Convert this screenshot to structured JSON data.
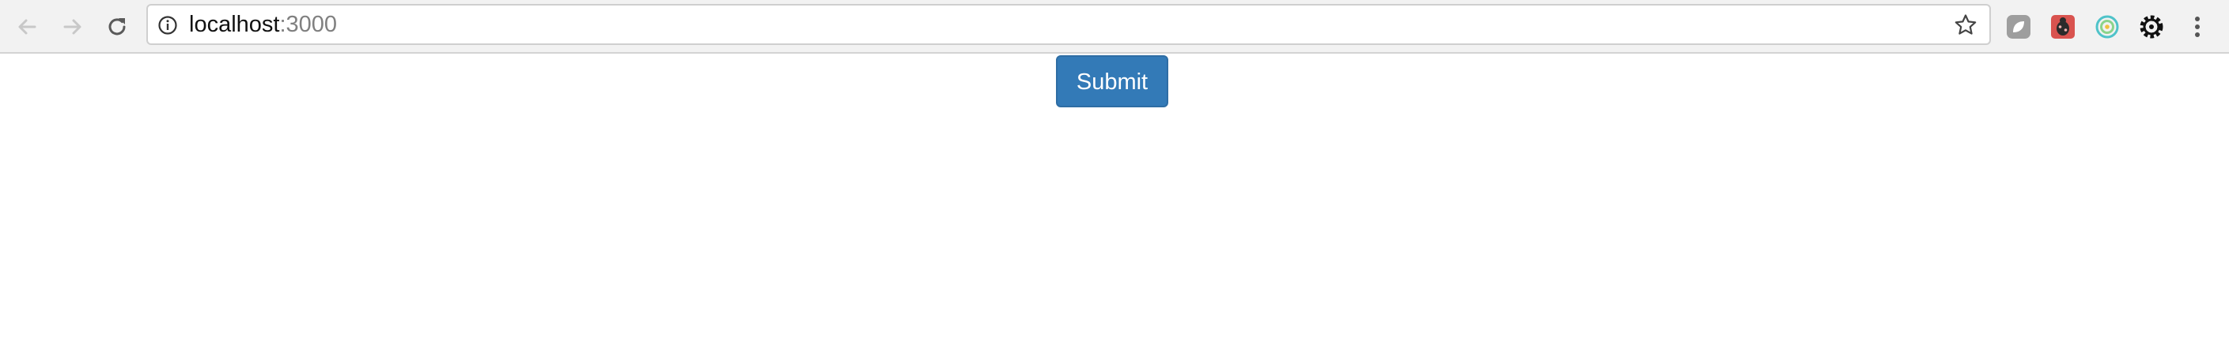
{
  "browser": {
    "address_bar": {
      "host": "localhost",
      "port": ":3000"
    },
    "icons": {
      "back": "back-arrow-icon",
      "forward": "forward-arrow-icon",
      "reload": "reload-icon",
      "info": "info-icon",
      "bookmark": "star-icon",
      "menu": "kebab-menu-icon"
    },
    "colors": {
      "toolbar": "#f2f2f2",
      "nav_disabled": "#c8c8c8",
      "nav_enabled": "#5a5a5a"
    }
  },
  "page": {
    "submit_label": "Submit",
    "button_color": "#337ab7"
  }
}
